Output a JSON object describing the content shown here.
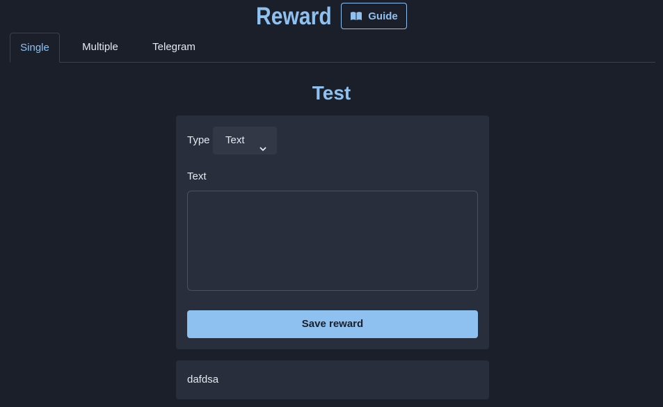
{
  "header": {
    "title": "Reward",
    "guide_label": "Guide"
  },
  "tabs": [
    {
      "label": "Single",
      "active": true
    },
    {
      "label": "Multiple",
      "active": false
    },
    {
      "label": "Telegram",
      "active": false
    }
  ],
  "section": {
    "title": "Test"
  },
  "form": {
    "type_label": "Type",
    "type_value": "Text",
    "text_label": "Text",
    "text_value": "",
    "save_label": "Save reward"
  },
  "items": [
    {
      "text": "dafdsa"
    }
  ],
  "colors": {
    "background": "#1b1f2a",
    "card": "#282e3b",
    "accent": "#8fc1f0",
    "text": "#e6e9ef"
  },
  "icons": {
    "guide": "book-open-icon",
    "select": "chevron-down-icon"
  }
}
